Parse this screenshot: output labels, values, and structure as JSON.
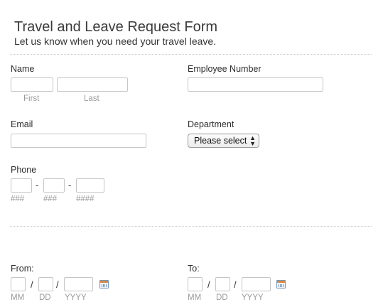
{
  "form": {
    "title": "Travel and Leave Request Form",
    "subtitle": "Let us know when you need your travel leave."
  },
  "fields": {
    "name": {
      "label": "Name",
      "first_sub": "First",
      "last_sub": "Last"
    },
    "employee_number": {
      "label": "Employee Number"
    },
    "email": {
      "label": "Email"
    },
    "department": {
      "label": "Department",
      "selected": "Please select"
    },
    "phone": {
      "label": "Phone",
      "sep": "-",
      "sub1": "###",
      "sub2": "###",
      "sub3": "####"
    },
    "from": {
      "label": "From:",
      "sep": "/",
      "mm": "MM",
      "dd": "DD",
      "yyyy": "YYYY",
      "icon": "calendar-icon"
    },
    "to": {
      "label": "To:",
      "sep": "/",
      "mm": "MM",
      "dd": "DD",
      "yyyy": "YYYY",
      "icon": "calendar-icon"
    }
  }
}
